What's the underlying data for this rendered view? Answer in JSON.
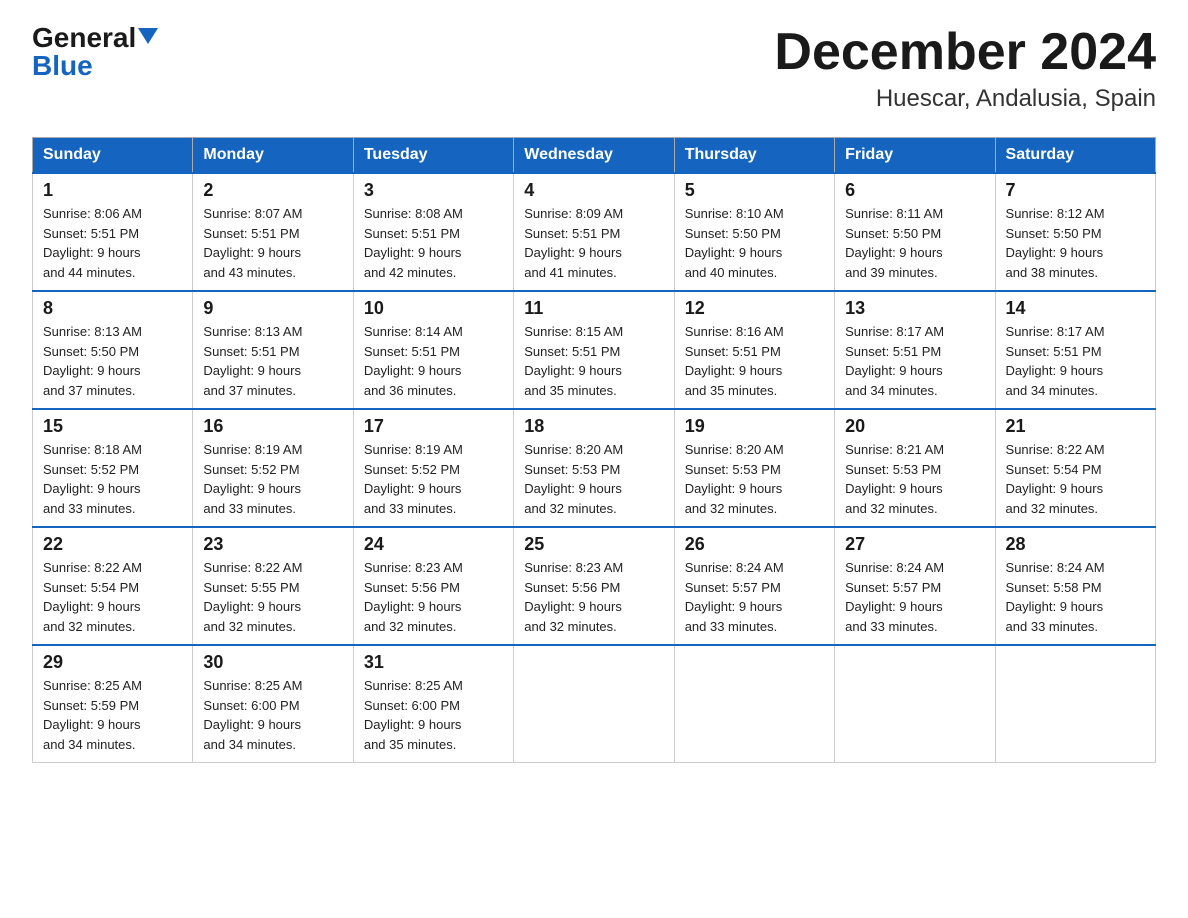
{
  "header": {
    "logo_general": "General",
    "logo_blue": "Blue",
    "title": "December 2024",
    "location": "Huescar, Andalusia, Spain"
  },
  "calendar": {
    "days_of_week": [
      "Sunday",
      "Monday",
      "Tuesday",
      "Wednesday",
      "Thursday",
      "Friday",
      "Saturday"
    ],
    "weeks": [
      [
        {
          "day": "1",
          "sunrise": "8:06 AM",
          "sunset": "5:51 PM",
          "daylight": "9 hours and 44 minutes."
        },
        {
          "day": "2",
          "sunrise": "8:07 AM",
          "sunset": "5:51 PM",
          "daylight": "9 hours and 43 minutes."
        },
        {
          "day": "3",
          "sunrise": "8:08 AM",
          "sunset": "5:51 PM",
          "daylight": "9 hours and 42 minutes."
        },
        {
          "day": "4",
          "sunrise": "8:09 AM",
          "sunset": "5:51 PM",
          "daylight": "9 hours and 41 minutes."
        },
        {
          "day": "5",
          "sunrise": "8:10 AM",
          "sunset": "5:50 PM",
          "daylight": "9 hours and 40 minutes."
        },
        {
          "day": "6",
          "sunrise": "8:11 AM",
          "sunset": "5:50 PM",
          "daylight": "9 hours and 39 minutes."
        },
        {
          "day": "7",
          "sunrise": "8:12 AM",
          "sunset": "5:50 PM",
          "daylight": "9 hours and 38 minutes."
        }
      ],
      [
        {
          "day": "8",
          "sunrise": "8:13 AM",
          "sunset": "5:50 PM",
          "daylight": "9 hours and 37 minutes."
        },
        {
          "day": "9",
          "sunrise": "8:13 AM",
          "sunset": "5:51 PM",
          "daylight": "9 hours and 37 minutes."
        },
        {
          "day": "10",
          "sunrise": "8:14 AM",
          "sunset": "5:51 PM",
          "daylight": "9 hours and 36 minutes."
        },
        {
          "day": "11",
          "sunrise": "8:15 AM",
          "sunset": "5:51 PM",
          "daylight": "9 hours and 35 minutes."
        },
        {
          "day": "12",
          "sunrise": "8:16 AM",
          "sunset": "5:51 PM",
          "daylight": "9 hours and 35 minutes."
        },
        {
          "day": "13",
          "sunrise": "8:17 AM",
          "sunset": "5:51 PM",
          "daylight": "9 hours and 34 minutes."
        },
        {
          "day": "14",
          "sunrise": "8:17 AM",
          "sunset": "5:51 PM",
          "daylight": "9 hours and 34 minutes."
        }
      ],
      [
        {
          "day": "15",
          "sunrise": "8:18 AM",
          "sunset": "5:52 PM",
          "daylight": "9 hours and 33 minutes."
        },
        {
          "day": "16",
          "sunrise": "8:19 AM",
          "sunset": "5:52 PM",
          "daylight": "9 hours and 33 minutes."
        },
        {
          "day": "17",
          "sunrise": "8:19 AM",
          "sunset": "5:52 PM",
          "daylight": "9 hours and 33 minutes."
        },
        {
          "day": "18",
          "sunrise": "8:20 AM",
          "sunset": "5:53 PM",
          "daylight": "9 hours and 32 minutes."
        },
        {
          "day": "19",
          "sunrise": "8:20 AM",
          "sunset": "5:53 PM",
          "daylight": "9 hours and 32 minutes."
        },
        {
          "day": "20",
          "sunrise": "8:21 AM",
          "sunset": "5:53 PM",
          "daylight": "9 hours and 32 minutes."
        },
        {
          "day": "21",
          "sunrise": "8:22 AM",
          "sunset": "5:54 PM",
          "daylight": "9 hours and 32 minutes."
        }
      ],
      [
        {
          "day": "22",
          "sunrise": "8:22 AM",
          "sunset": "5:54 PM",
          "daylight": "9 hours and 32 minutes."
        },
        {
          "day": "23",
          "sunrise": "8:22 AM",
          "sunset": "5:55 PM",
          "daylight": "9 hours and 32 minutes."
        },
        {
          "day": "24",
          "sunrise": "8:23 AM",
          "sunset": "5:56 PM",
          "daylight": "9 hours and 32 minutes."
        },
        {
          "day": "25",
          "sunrise": "8:23 AM",
          "sunset": "5:56 PM",
          "daylight": "9 hours and 32 minutes."
        },
        {
          "day": "26",
          "sunrise": "8:24 AM",
          "sunset": "5:57 PM",
          "daylight": "9 hours and 33 minutes."
        },
        {
          "day": "27",
          "sunrise": "8:24 AM",
          "sunset": "5:57 PM",
          "daylight": "9 hours and 33 minutes."
        },
        {
          "day": "28",
          "sunrise": "8:24 AM",
          "sunset": "5:58 PM",
          "daylight": "9 hours and 33 minutes."
        }
      ],
      [
        {
          "day": "29",
          "sunrise": "8:25 AM",
          "sunset": "5:59 PM",
          "daylight": "9 hours and 34 minutes."
        },
        {
          "day": "30",
          "sunrise": "8:25 AM",
          "sunset": "6:00 PM",
          "daylight": "9 hours and 34 minutes."
        },
        {
          "day": "31",
          "sunrise": "8:25 AM",
          "sunset": "6:00 PM",
          "daylight": "9 hours and 35 minutes."
        },
        null,
        null,
        null,
        null
      ]
    ]
  }
}
